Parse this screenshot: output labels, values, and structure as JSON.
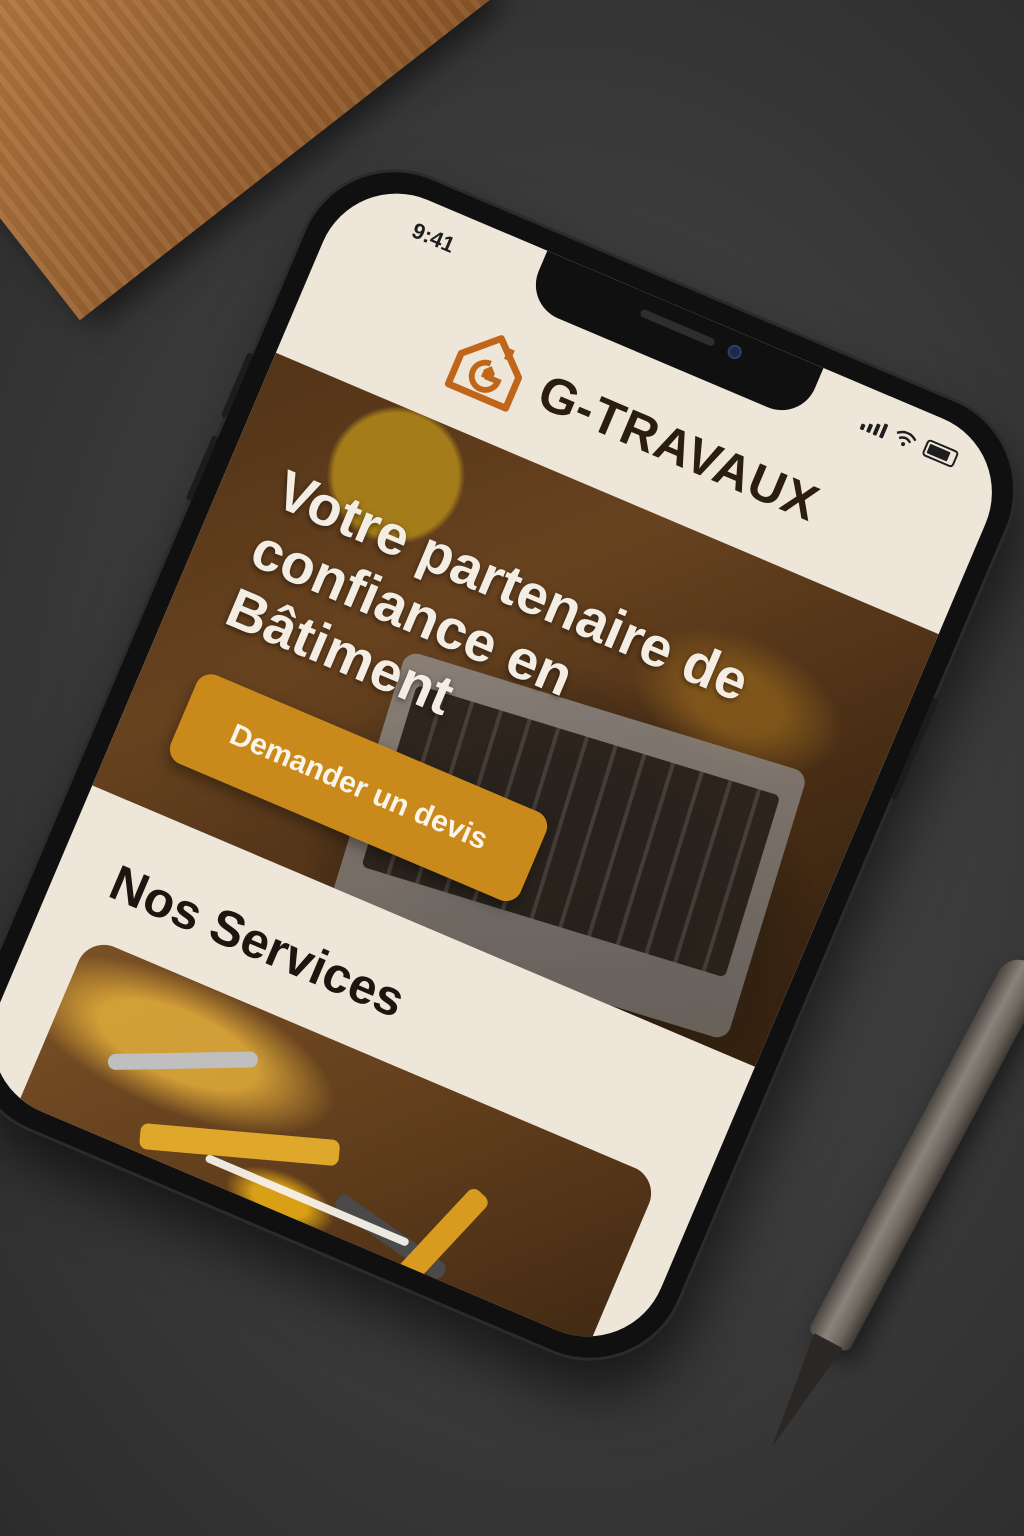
{
  "status_bar": {
    "time": "9:41"
  },
  "header": {
    "brand": "G-TRAVAUX"
  },
  "hero": {
    "title": "Votre partenaire de confiance en Bâtiment",
    "cta_label": "Demander un devis"
  },
  "services": {
    "title": "Nos Services"
  },
  "colors": {
    "accent": "#c98a1b",
    "logo": "#c0661a",
    "background": "#efe6da",
    "text_dark": "#2b1d12"
  },
  "icons": [
    "house-logo-icon",
    "signal-icon",
    "wifi-icon",
    "battery-icon"
  ]
}
